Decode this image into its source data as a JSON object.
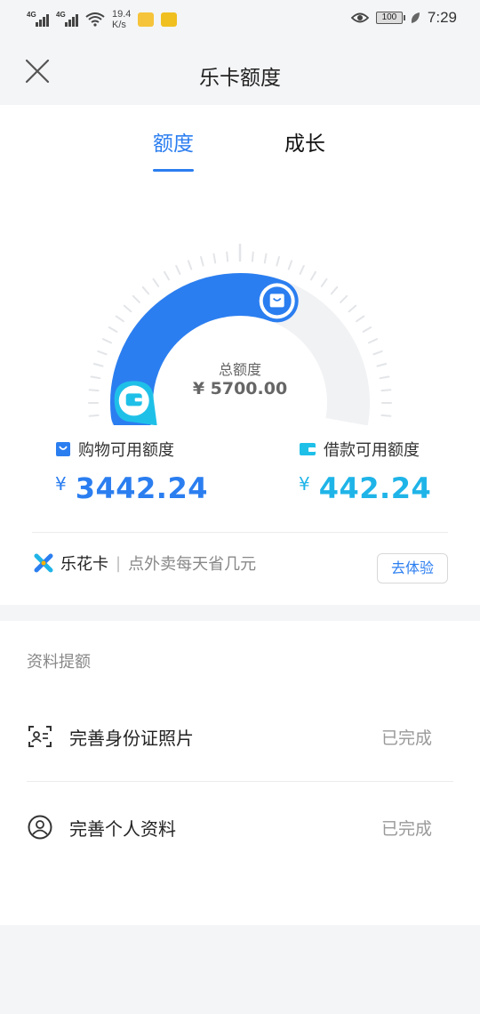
{
  "status_bar": {
    "network_1": "4G",
    "network_2": "4G",
    "speed_value": "19.4",
    "speed_unit": "K/s",
    "battery": "100",
    "time": "7:29"
  },
  "header": {
    "title": "乐卡额度",
    "close_icon": "close-icon"
  },
  "tabs": [
    {
      "label": "额度",
      "active": true
    },
    {
      "label": "成长",
      "active": false
    }
  ],
  "gauge": {
    "total_label": "总额度",
    "total_value": "¥ 5700.00",
    "used_fraction": 0.6,
    "colors": {
      "shop": "#2b7ef0",
      "loan": "#1fc0e8",
      "track": "#f1f2f4"
    }
  },
  "stats": {
    "shopping": {
      "label": "购物可用额度",
      "currency": "¥",
      "value": "3442.24",
      "icon": "shopping-bag-icon"
    },
    "loan": {
      "label": "借款可用额度",
      "currency": "¥",
      "value": "442.24",
      "icon": "wallet-icon"
    }
  },
  "promo": {
    "brand": "乐花卡",
    "separator": "|",
    "desc": "点外卖每天省几元",
    "button": "去体验",
    "icon": "lehua-logo-icon"
  },
  "materials": {
    "title": "资料提额",
    "items": [
      {
        "label": "完善身份证照片",
        "status": "已完成",
        "icon": "id-card-icon"
      },
      {
        "label": "完善个人资料",
        "status": "已完成",
        "icon": "user-profile-icon"
      }
    ]
  }
}
